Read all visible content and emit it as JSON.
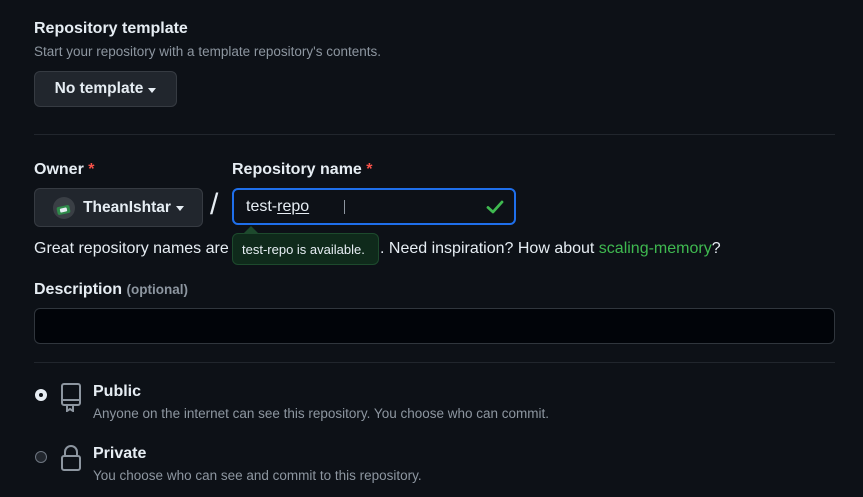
{
  "template": {
    "title": "Repository template",
    "description": "Start your repository with a template repository's contents.",
    "button_label": "No template"
  },
  "owner": {
    "label": "Owner",
    "required_mark": "*",
    "value": "TheanIshtar"
  },
  "separator": "/",
  "repo_name": {
    "label": "Repository name",
    "required_mark": "*",
    "value_start": "test-",
    "value_underlined": "repo",
    "status_icon": "check-icon",
    "tooltip": "test-repo is available."
  },
  "hint": {
    "prefix": "Great repository names are s",
    "suffix": ". Need inspiration? How about ",
    "suggestion": "scaling-memory",
    "end": "?"
  },
  "description": {
    "label": "Description",
    "optional": "(optional)",
    "value": ""
  },
  "visibility": {
    "options": [
      {
        "name": "public",
        "title": "Public",
        "description": "Anyone on the internet can see this repository. You choose who can commit.",
        "icon": "repo-icon",
        "selected": true
      },
      {
        "name": "private",
        "title": "Private",
        "description": "You choose who can see and commit to this repository.",
        "icon": "lock-icon",
        "selected": false
      }
    ]
  },
  "colors": {
    "background": "#0d1117",
    "accent_blue": "#1f6feb",
    "success_green": "#3fb950",
    "danger_red": "#f85149"
  }
}
